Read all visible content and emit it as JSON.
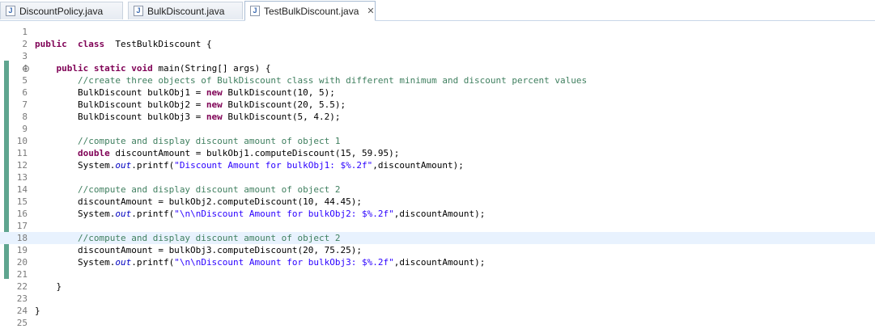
{
  "tabs": [
    {
      "label": "DiscountPolicy.java",
      "icon": "java-file-icon",
      "active": false
    },
    {
      "label": "BulkDiscount.java",
      "icon": "java-file-icon",
      "active": false
    },
    {
      "label": "TestBulkDiscount.java",
      "icon": "java-file-icon",
      "active": true
    }
  ],
  "editor": {
    "current_line": 18,
    "lines": [
      {
        "n": "1",
        "tokens": []
      },
      {
        "n": "2",
        "tokens": [
          [
            "kw",
            "public"
          ],
          [
            "",
            "  "
          ],
          [
            "kw",
            "class"
          ],
          [
            "",
            "  TestBulkDiscount {"
          ]
        ]
      },
      {
        "n": "3",
        "tokens": []
      },
      {
        "n": "4",
        "fold": true,
        "tokens": [
          [
            "",
            "    "
          ],
          [
            "kw",
            "public"
          ],
          [
            "",
            " "
          ],
          [
            "kw",
            "static"
          ],
          [
            "",
            " "
          ],
          [
            "kw",
            "void"
          ],
          [
            "",
            " main(String[] args) {"
          ]
        ]
      },
      {
        "n": "5",
        "tokens": [
          [
            "",
            "        "
          ],
          [
            "cm",
            "//create three objects of BulkDiscount class with different minimum and discount percent values"
          ]
        ]
      },
      {
        "n": "6",
        "tokens": [
          [
            "",
            "        BulkDiscount bulkObj1 = "
          ],
          [
            "kw",
            "new"
          ],
          [
            "",
            " BulkDiscount(10, 5);"
          ]
        ]
      },
      {
        "n": "7",
        "tokens": [
          [
            "",
            "        BulkDiscount bulkObj2 = "
          ],
          [
            "kw",
            "new"
          ],
          [
            "",
            " BulkDiscount(20, 5.5);"
          ]
        ]
      },
      {
        "n": "8",
        "tokens": [
          [
            "",
            "        BulkDiscount bulkObj3 = "
          ],
          [
            "kw",
            "new"
          ],
          [
            "",
            " BulkDiscount(5, 4.2);"
          ]
        ]
      },
      {
        "n": "9",
        "tokens": []
      },
      {
        "n": "10",
        "tokens": [
          [
            "",
            "        "
          ],
          [
            "cm",
            "//compute and display discount amount of object 1"
          ]
        ]
      },
      {
        "n": "11",
        "tokens": [
          [
            "",
            "        "
          ],
          [
            "kw",
            "double"
          ],
          [
            "",
            " discountAmount = bulkObj1.computeDiscount(15, 59.95);"
          ]
        ]
      },
      {
        "n": "12",
        "tokens": [
          [
            "",
            "        System."
          ],
          [
            "fld",
            "out"
          ],
          [
            "",
            ".printf("
          ],
          [
            "st",
            "\"Discount Amount for bulkObj1: $%.2f\""
          ],
          [
            "",
            ",discountAmount);"
          ]
        ]
      },
      {
        "n": "13",
        "tokens": []
      },
      {
        "n": "14",
        "tokens": [
          [
            "",
            "        "
          ],
          [
            "cm",
            "//compute and display discount amount of object 2"
          ]
        ]
      },
      {
        "n": "15",
        "tokens": [
          [
            "",
            "        discountAmount = bulkObj2.computeDiscount(10, 44.45);"
          ]
        ]
      },
      {
        "n": "16",
        "tokens": [
          [
            "",
            "        System."
          ],
          [
            "fld",
            "out"
          ],
          [
            "",
            ".printf("
          ],
          [
            "st",
            "\"\\n\\nDiscount Amount for bulkObj2: $%.2f\""
          ],
          [
            "",
            ",discountAmount);"
          ]
        ]
      },
      {
        "n": "17",
        "tokens": []
      },
      {
        "n": "18",
        "tokens": [
          [
            "",
            "        "
          ],
          [
            "cm",
            "//compute and display discount amount of object 2"
          ]
        ]
      },
      {
        "n": "19",
        "tokens": [
          [
            "",
            "        discountAmount = bulkObj3.computeDiscount(20, 75.25);"
          ]
        ]
      },
      {
        "n": "20",
        "tokens": [
          [
            "",
            "        System."
          ],
          [
            "fld",
            "out"
          ],
          [
            "",
            ".printf("
          ],
          [
            "st",
            "\"\\n\\nDiscount Amount for bulkObj3: $%.2f\""
          ],
          [
            "",
            ",discountAmount);"
          ]
        ]
      },
      {
        "n": "21",
        "tokens": []
      },
      {
        "n": "22",
        "tokens": [
          [
            "",
            "    }"
          ]
        ]
      },
      {
        "n": "23",
        "tokens": []
      },
      {
        "n": "24",
        "tokens": [
          [
            "",
            "}"
          ]
        ]
      },
      {
        "n": "25",
        "tokens": []
      }
    ]
  },
  "colors": {
    "keyword": "#7f0055",
    "comment": "#3f7f5f",
    "string": "#2a00ff",
    "field": "#0000c0",
    "current_line_bg": "#e8f2fe",
    "overview_ruler": "#5fa58f"
  }
}
